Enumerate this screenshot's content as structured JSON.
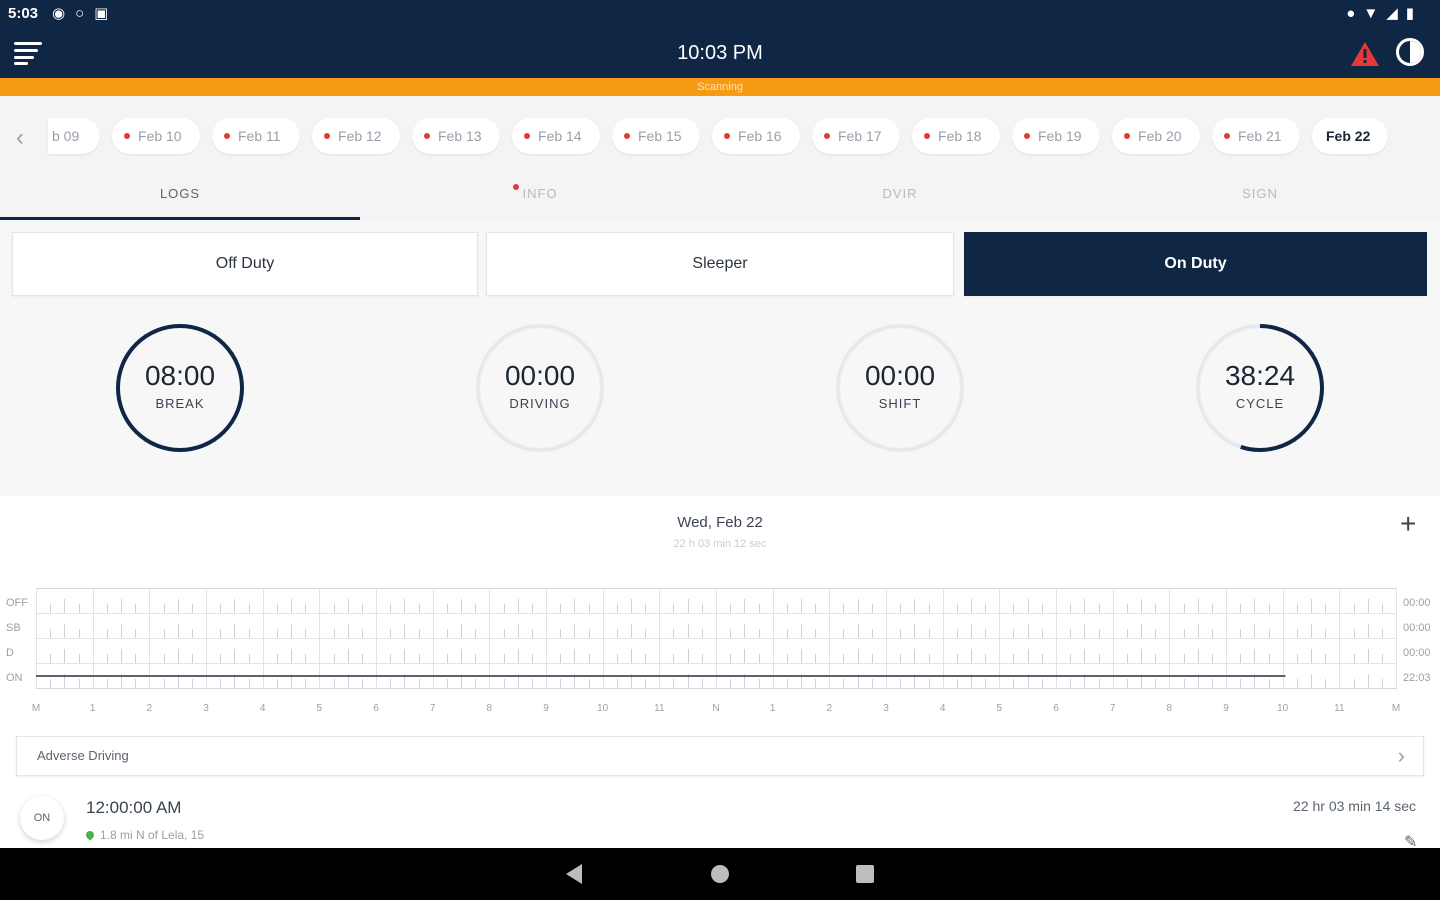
{
  "status_bar": {
    "time": "5:03",
    "left_icons": [
      "message-icon",
      "drop-icon",
      "bus-icon"
    ],
    "right_icons": [
      "location-icon",
      "wifi-icon",
      "signal-icon",
      "battery-icon"
    ]
  },
  "app_bar": {
    "time": "10:03 PM",
    "menu_icon": "menu-icon",
    "alert_icon": "warning-icon",
    "theme_icon": "contrast-icon"
  },
  "scan_banner": "Scanning",
  "dates": [
    {
      "label": "b 09",
      "dot": false
    },
    {
      "label": "Feb 10",
      "dot": true
    },
    {
      "label": "Feb 11",
      "dot": true
    },
    {
      "label": "Feb 12",
      "dot": true
    },
    {
      "label": "Feb 13",
      "dot": true
    },
    {
      "label": "Feb 14",
      "dot": true
    },
    {
      "label": "Feb 15",
      "dot": true
    },
    {
      "label": "Feb 16",
      "dot": true
    },
    {
      "label": "Feb 17",
      "dot": true
    },
    {
      "label": "Feb 18",
      "dot": true
    },
    {
      "label": "Feb 19",
      "dot": true
    },
    {
      "label": "Feb 20",
      "dot": true
    },
    {
      "label": "Feb 21",
      "dot": true
    },
    {
      "label": "Feb 22",
      "dot": false,
      "active": true
    }
  ],
  "tabs": [
    {
      "label": "LOGS",
      "active": true
    },
    {
      "label": "INFO",
      "dot": true
    },
    {
      "label": "DVIR"
    },
    {
      "label": "SIGN"
    }
  ],
  "duty_status": {
    "off_duty": "Off Duty",
    "sleeper": "Sleeper",
    "on_duty": "On Duty",
    "selected": "on_duty"
  },
  "gauges": [
    {
      "value": "08:00",
      "label": "BREAK",
      "fraction": 1.0
    },
    {
      "value": "00:00",
      "label": "DRIVING",
      "fraction": 0.0
    },
    {
      "value": "00:00",
      "label": "SHIFT",
      "fraction": 0.0
    },
    {
      "value": "38:24",
      "label": "CYCLE",
      "fraction": 0.55
    }
  ],
  "log": {
    "date": "Wed, Feb 22",
    "duration": "22 h 03 min 12 sec",
    "rows": [
      "OFF",
      "SB",
      "D",
      "ON"
    ],
    "totals": [
      "00:00",
      "00:00",
      "00:00",
      "22:03"
    ],
    "hour_labels": [
      "M",
      "1",
      "2",
      "3",
      "4",
      "5",
      "6",
      "7",
      "8",
      "9",
      "10",
      "11",
      "N",
      "1",
      "2",
      "3",
      "4",
      "5",
      "6",
      "7",
      "8",
      "9",
      "10",
      "11",
      "M"
    ],
    "segments": [
      {
        "status": "ON",
        "start_hour": 0,
        "end_hour": 22.05
      }
    ]
  },
  "adverse_driving": "Adverse Driving",
  "events": [
    {
      "status": "ON",
      "time": "12:00:00 AM",
      "location": "1.8 mi N of Lela, 15",
      "duration": "22 hr 03 min 14 sec"
    }
  ],
  "colors": {
    "primary": "#0f2645",
    "accent": "#f59b14",
    "alert": "#e53935",
    "gauge_track": "#e6e9ee"
  }
}
